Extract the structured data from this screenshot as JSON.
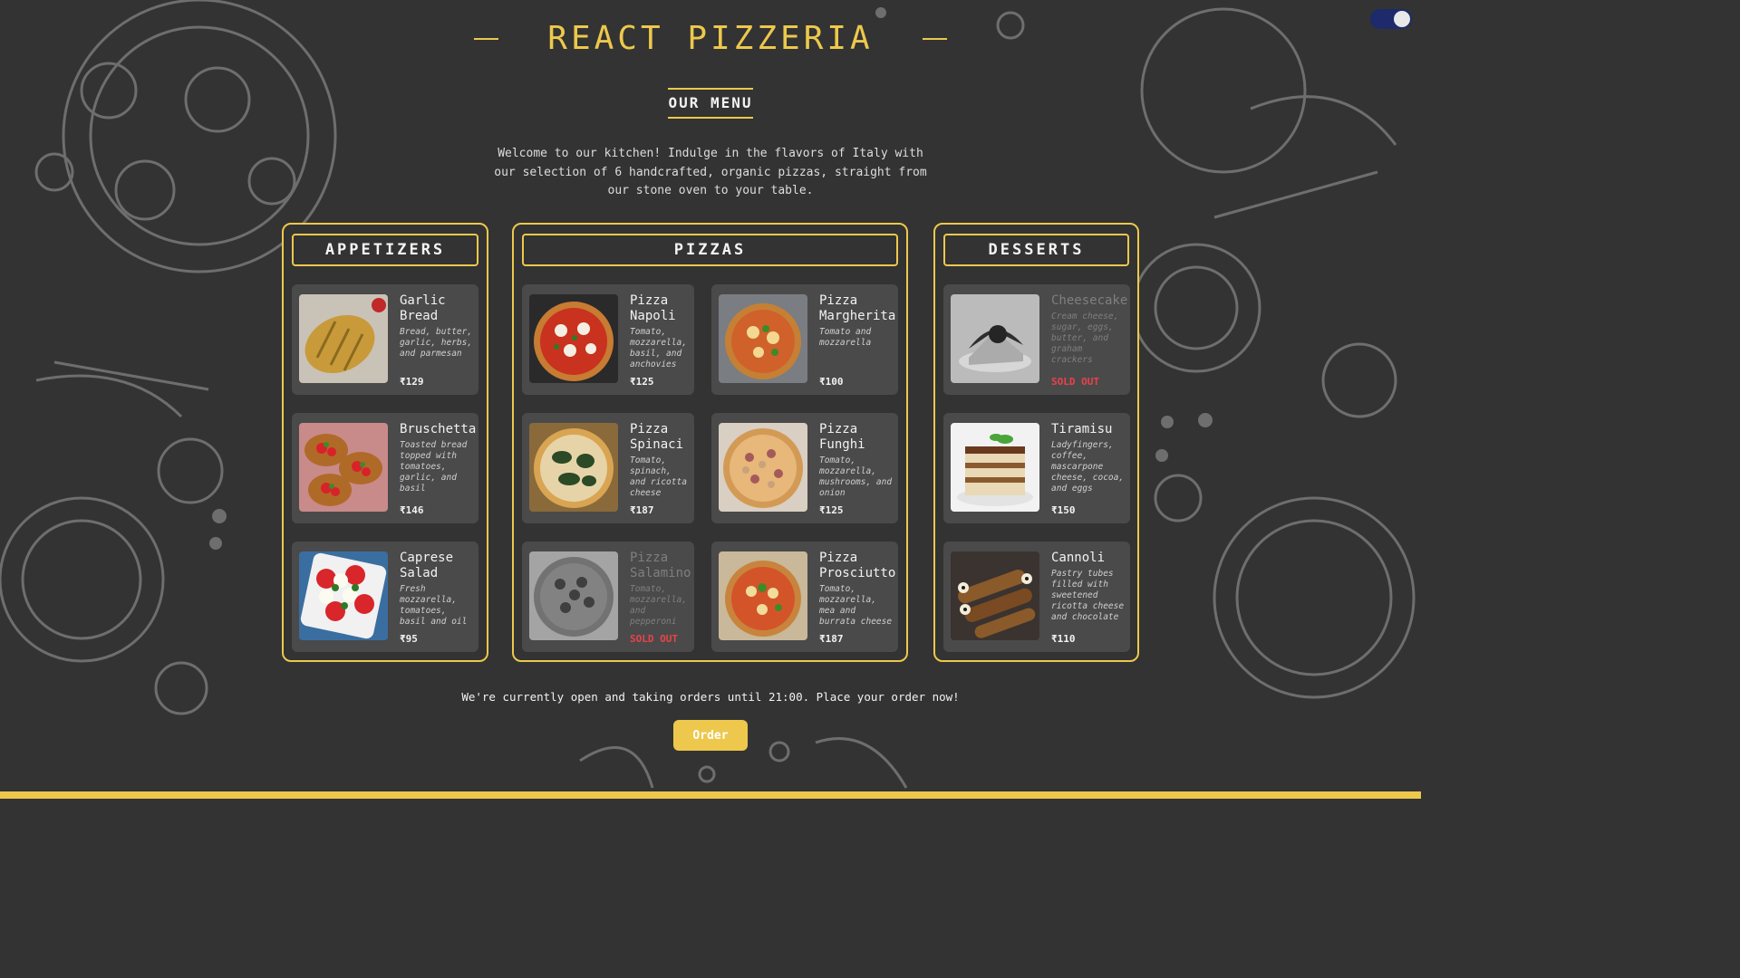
{
  "header": {
    "title": "REACT PIZZERIA",
    "subtitle": "OUR MENU",
    "intro": "Welcome to our kitchen! Indulge in the flavors of Italy with our selection of 6 handcrafted, organic pizzas, straight from our stone oven to your table."
  },
  "theme": {
    "accent": "#edc84c",
    "background": "#333333",
    "card": "#4a4a4a",
    "sold_out": "#e8434a"
  },
  "theme_toggle": {
    "state": "dark"
  },
  "appetizers": {
    "title": "APPETIZERS",
    "items": [
      {
        "name": "Garlic Bread",
        "desc": "Bread, butter, garlic, herbs, and parmesan",
        "price": "₹129",
        "icon": "garlic-bread"
      },
      {
        "name": "Bruschetta",
        "desc": "Toasted bread topped with tomatoes, garlic, and basil",
        "price": "₹146",
        "icon": "bruschetta"
      },
      {
        "name": "Caprese Salad",
        "desc": "Fresh mozzarella, tomatoes, basil and oil",
        "price": "₹95",
        "icon": "caprese-salad"
      }
    ]
  },
  "pizzas": {
    "title": "PIZZAS",
    "items": [
      {
        "name": "Pizza Napoli",
        "desc": "Tomato, mozzarella, basil, and anchovies",
        "price": "₹125",
        "icon": "pizza"
      },
      {
        "name": "Pizza Margherita",
        "desc": "Tomato and mozzarella",
        "price": "₹100",
        "icon": "pizza"
      },
      {
        "name": "Pizza Spinaci",
        "desc": "Tomato, spinach, and ricotta cheese",
        "price": "₹187",
        "icon": "pizza"
      },
      {
        "name": "Pizza Funghi",
        "desc": "Tomato, mozzarella, mushrooms, and onion",
        "price": "₹125",
        "icon": "pizza"
      },
      {
        "name": "Pizza Salamino",
        "desc": "Tomato, mozzarella, and pepperoni",
        "status": "SOLD OUT",
        "icon": "pizza"
      },
      {
        "name": "Pizza Prosciutto",
        "desc": "Tomato, mozzarella, mea and burrata cheese",
        "price": "₹187",
        "icon": "pizza"
      }
    ]
  },
  "desserts": {
    "title": "DESSERTS",
    "items": [
      {
        "name": "Cheesecake",
        "desc": "Cream cheese, sugar, eggs, butter, and graham crackers",
        "status": "SOLD OUT",
        "icon": "cheesecake"
      },
      {
        "name": "Tiramisu",
        "desc": "Ladyfingers, coffee, mascarpone cheese, cocoa, and eggs",
        "price": "₹150",
        "icon": "tiramisu"
      },
      {
        "name": "Cannoli",
        "desc": "Pastry tubes filled with sweetened ricotta cheese and chocolate",
        "price": "₹110",
        "icon": "cannoli"
      }
    ]
  },
  "footer": {
    "message": "We're currently open and taking orders until 21:00. Place your order now!",
    "order_label": "Order"
  }
}
